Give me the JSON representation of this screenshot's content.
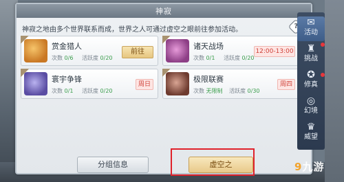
{
  "panel": {
    "title": "神寂",
    "intro": "神寂之地由多个世界联系而成，世界之人可通过虚空之眼前往参加活动。",
    "help_symbol": "?"
  },
  "cards": [
    {
      "name": "赏金猎人",
      "count_label": "次数",
      "count_value": "0/6",
      "active_label": "活跃度",
      "active_value": "0/20",
      "action": "前往",
      "thumb_color": "#d98f3a"
    },
    {
      "name": "诸天战场",
      "count_label": "次数",
      "count_value": "0/1",
      "active_label": "活跃度",
      "active_value": "0/20",
      "badge": "12:00-13:00",
      "thumb_color": "#b55aa8"
    },
    {
      "name": "寰宇争锋",
      "count_label": "次数",
      "count_value": "0/1",
      "active_label": "活跃度",
      "active_value": "0/20",
      "badge": "周日",
      "thumb_color": "#7a6bc2"
    },
    {
      "name": "极限联赛",
      "count_label": "次数",
      "count_value": "无限制",
      "active_label": "活跃度",
      "active_value": "0/30",
      "badge": "周四",
      "thumb_color": "#a56a58"
    }
  ],
  "buttons": {
    "group_info": "分组信息",
    "void": "虚空之"
  },
  "sidebar": {
    "items": [
      {
        "label": "活动",
        "glyph": "✉"
      },
      {
        "label": "挑战",
        "glyph": "♜"
      },
      {
        "label": "修真",
        "glyph": "✪"
      },
      {
        "label": "幻境",
        "glyph": "◎"
      },
      {
        "label": "威望",
        "glyph": "♛"
      }
    ]
  },
  "watermark": {
    "nine": "9",
    "text": "九游"
  }
}
